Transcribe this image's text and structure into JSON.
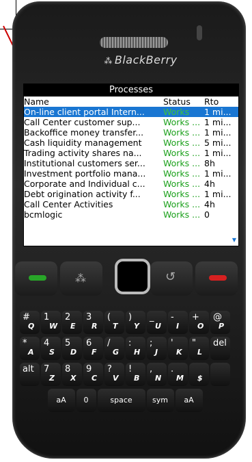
{
  "brand": {
    "name": "BlackBerry",
    "logo": "blackberry-logo-icon"
  },
  "screen": {
    "title": "Processes",
    "columns": {
      "name": "Name",
      "status": "Status",
      "rto": "Rto"
    },
    "rows": [
      {
        "name": "On-line client portal Intern...",
        "status": "Works",
        "rto": "1 mi..."
      },
      {
        "name": "Call Center customer sup...",
        "status": "Works ...",
        "rto": "1 mi..."
      },
      {
        "name": "Backoffice money transfer...",
        "status": "Works ...",
        "rto": "1 mi..."
      },
      {
        "name": "Cash liquidity management",
        "status": "Works ...",
        "rto": "5 mi..."
      },
      {
        "name": "Trading activity shares na...",
        "status": "Works ...",
        "rto": "1 mi..."
      },
      {
        "name": "Institutional customers ser...",
        "status": "Works ...",
        "rto": "8h"
      },
      {
        "name": "Investment portfolio mana...",
        "status": "Works ...",
        "rto": "1 mi..."
      },
      {
        "name": "Corporate and Individual c...",
        "status": "Works ...",
        "rto": "4h"
      },
      {
        "name": "Debt origination activity f...",
        "status": "Works ...",
        "rto": "1 mi..."
      },
      {
        "name": "Call Center Activities",
        "status": "Works ...",
        "rto": "4h"
      },
      {
        "name": "bcmlogic",
        "status": "Works ...",
        "rto": "0"
      }
    ],
    "selected_row": 0,
    "scroll_indicator": "scroll-down-icon"
  },
  "keyboard": {
    "rows": [
      [
        {
          "t": "#",
          "b": "Q"
        },
        {
          "t": "1",
          "b": "W"
        },
        {
          "t": "2",
          "b": "E"
        },
        {
          "t": "3",
          "b": "R"
        },
        {
          "t": "(",
          "b": "T"
        },
        {
          "t": ")",
          "b": "Y"
        },
        {
          "t": "_",
          "b": "U"
        },
        {
          "t": "-",
          "b": "I"
        },
        {
          "t": "+",
          "b": "O"
        },
        {
          "t": "@",
          "b": "P"
        }
      ],
      [
        {
          "t": "*",
          "b": "A"
        },
        {
          "t": "4",
          "b": "S"
        },
        {
          "t": "5",
          "b": "D"
        },
        {
          "t": "6",
          "b": "F"
        },
        {
          "t": "/",
          "b": "G"
        },
        {
          "t": ":",
          "b": "H"
        },
        {
          "t": ";",
          "b": "J"
        },
        {
          "t": "'",
          "b": "K"
        },
        {
          "t": "\"",
          "b": "L"
        },
        {
          "t": "del",
          "b": ""
        }
      ],
      [
        {
          "t": "alt",
          "b": ""
        },
        {
          "t": "7",
          "b": "Z"
        },
        {
          "t": "8",
          "b": "X"
        },
        {
          "t": "9",
          "b": "C"
        },
        {
          "t": "?",
          "b": "V"
        },
        {
          "t": "!",
          "b": "B"
        },
        {
          "t": ",",
          "b": "N"
        },
        {
          "t": ".",
          "b": "M"
        },
        {
          "t": "",
          "b": "$"
        },
        {
          "t": "",
          "b": ""
        }
      ]
    ],
    "bottom": {
      "shift_left": "aA",
      "zero": "0",
      "space": "space",
      "sym": "sym",
      "shift_right": "aA"
    }
  },
  "colors": {
    "selection": "#1976d2",
    "status_green": "#1ba01b",
    "arrow": "#cc0000"
  }
}
